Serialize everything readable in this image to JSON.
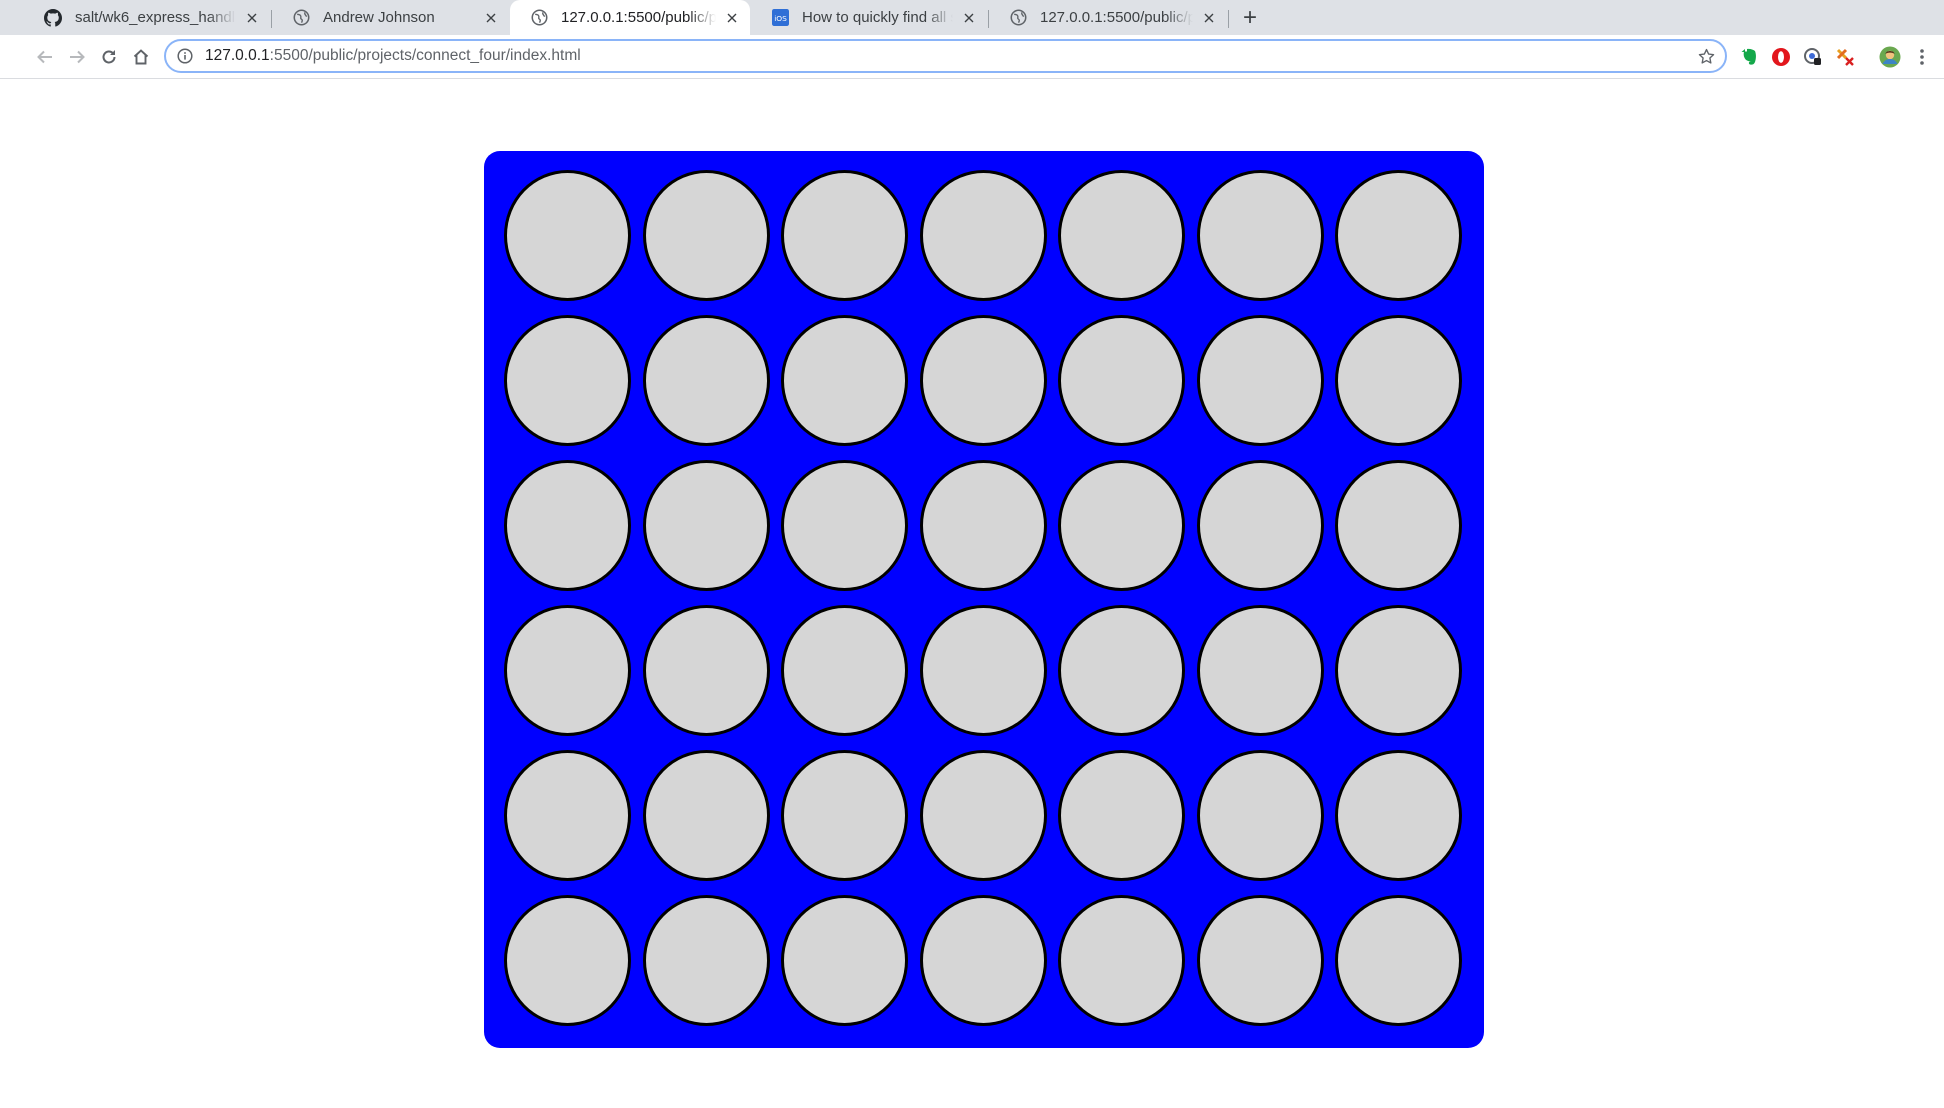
{
  "browser": {
    "tabs": [
      {
        "title": "salt/wk6_express_handlebars a",
        "favicon": "github-icon",
        "active": false
      },
      {
        "title": "Andrew Johnson",
        "favicon": "globe-icon",
        "active": false
      },
      {
        "title": "127.0.0.1:5500/public/projects/",
        "favicon": "globe-icon",
        "active": true
      },
      {
        "title": "How to quickly find all screensh",
        "favicon": "ios-site-icon",
        "active": false
      },
      {
        "title": "127.0.0.1:5500/public/projects/",
        "favicon": "globe-icon",
        "active": false
      }
    ],
    "new_tab_label": "+",
    "address_bar": {
      "host": "127.0.0.1",
      "rest": ":5500/public/projects/connect_four/index.html"
    },
    "extensions": [
      "evernote-icon",
      "opera-icon",
      "privacy-extension-icon",
      "block-site-icon",
      "profile-avatar-icon"
    ]
  },
  "game": {
    "rows": 6,
    "columns": 7,
    "cells": [
      [
        "empty",
        "empty",
        "empty",
        "empty",
        "empty",
        "empty",
        "empty"
      ],
      [
        "empty",
        "empty",
        "empty",
        "empty",
        "empty",
        "empty",
        "empty"
      ],
      [
        "empty",
        "empty",
        "empty",
        "empty",
        "empty",
        "empty",
        "empty"
      ],
      [
        "empty",
        "empty",
        "empty",
        "empty",
        "empty",
        "empty",
        "empty"
      ],
      [
        "empty",
        "empty",
        "empty",
        "empty",
        "empty",
        "empty",
        "empty"
      ],
      [
        "empty",
        "empty",
        "empty",
        "empty",
        "empty",
        "empty",
        "empty"
      ]
    ]
  },
  "colors": {
    "board": "#0000ff",
    "empty_slot": "#d6d6d6",
    "slot_border": "#000000",
    "page_background": "#ffffff"
  }
}
